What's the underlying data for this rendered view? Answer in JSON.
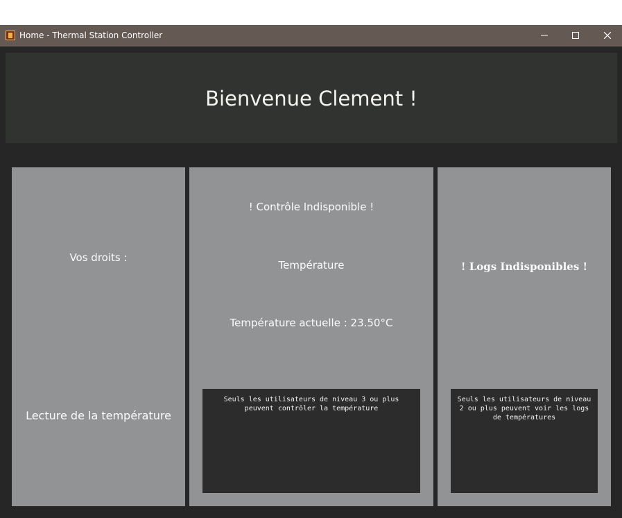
{
  "window": {
    "title": "Home - Thermal Station Controller",
    "icon": "app-icon",
    "controls": {
      "minimize_icon": "minimize-icon",
      "maximize_icon": "maximize-icon",
      "close_icon": "close-icon"
    }
  },
  "header": {
    "welcome_text": "Bienvenue Clement !"
  },
  "rights_panel": {
    "heading": "Vos droits :",
    "right_item": "Lecture de la température"
  },
  "control_panel": {
    "status": "! Contrôle Indisponible !",
    "section_label": "Température",
    "current_temperature": "Température actuelle : 23.50°C",
    "notice": "Seuls les utilisateurs de niveau 3 ou plus peuvent contrôler la température"
  },
  "logs_panel": {
    "status": "! Logs Indisponibles !",
    "notice": "Seuls les utilisateurs de niveau 2 ou plus peuvent voir les logs de températures"
  },
  "colors": {
    "titlebar": "#645953",
    "window_background": "#262626",
    "header_background": "#313330",
    "panel_background": "#929395",
    "notice_background": "#2c2c2c",
    "text": "#ffffff"
  }
}
